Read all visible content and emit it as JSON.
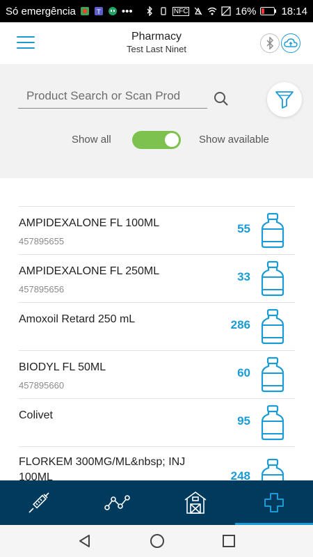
{
  "status_bar": {
    "carrier": "Só emergência",
    "battery": "16%",
    "time": "18:14",
    "nfc": "NFC"
  },
  "header": {
    "title": "Pharmacy",
    "subtitle": "Test Last Ninet"
  },
  "search": {
    "placeholder": "Product Search or Scan Prod"
  },
  "toggle": {
    "left_label": "Show all",
    "right_label": "Show available",
    "state": "on"
  },
  "products": [
    {
      "name": "AMPIDEXALONE   FL 100ML",
      "code": "457895655",
      "qty": "55"
    },
    {
      "name": "AMPIDEXALONE   FL 250ML",
      "code": "457895656",
      "qty": "33"
    },
    {
      "name": "Amoxoil Retard 250 mL",
      "code": "",
      "qty": "286"
    },
    {
      "name": "BIODYL FL 50ML",
      "code": "457895660",
      "qty": "60"
    },
    {
      "name": "Colivet",
      "code": "",
      "qty": "95"
    },
    {
      "name": "FLORKEM 300MG/ML&nbsp; INJ 100ML",
      "code": "",
      "qty": "248"
    }
  ],
  "bottom_nav": {
    "items": [
      "syringe-icon",
      "chart-line-icon",
      "barn-icon",
      "pharmacy-cross-icon"
    ],
    "active": 3
  },
  "colors": {
    "accent": "#1a9bd6",
    "nav_bg": "#003a5d",
    "toggle_on": "#7dc24e"
  }
}
